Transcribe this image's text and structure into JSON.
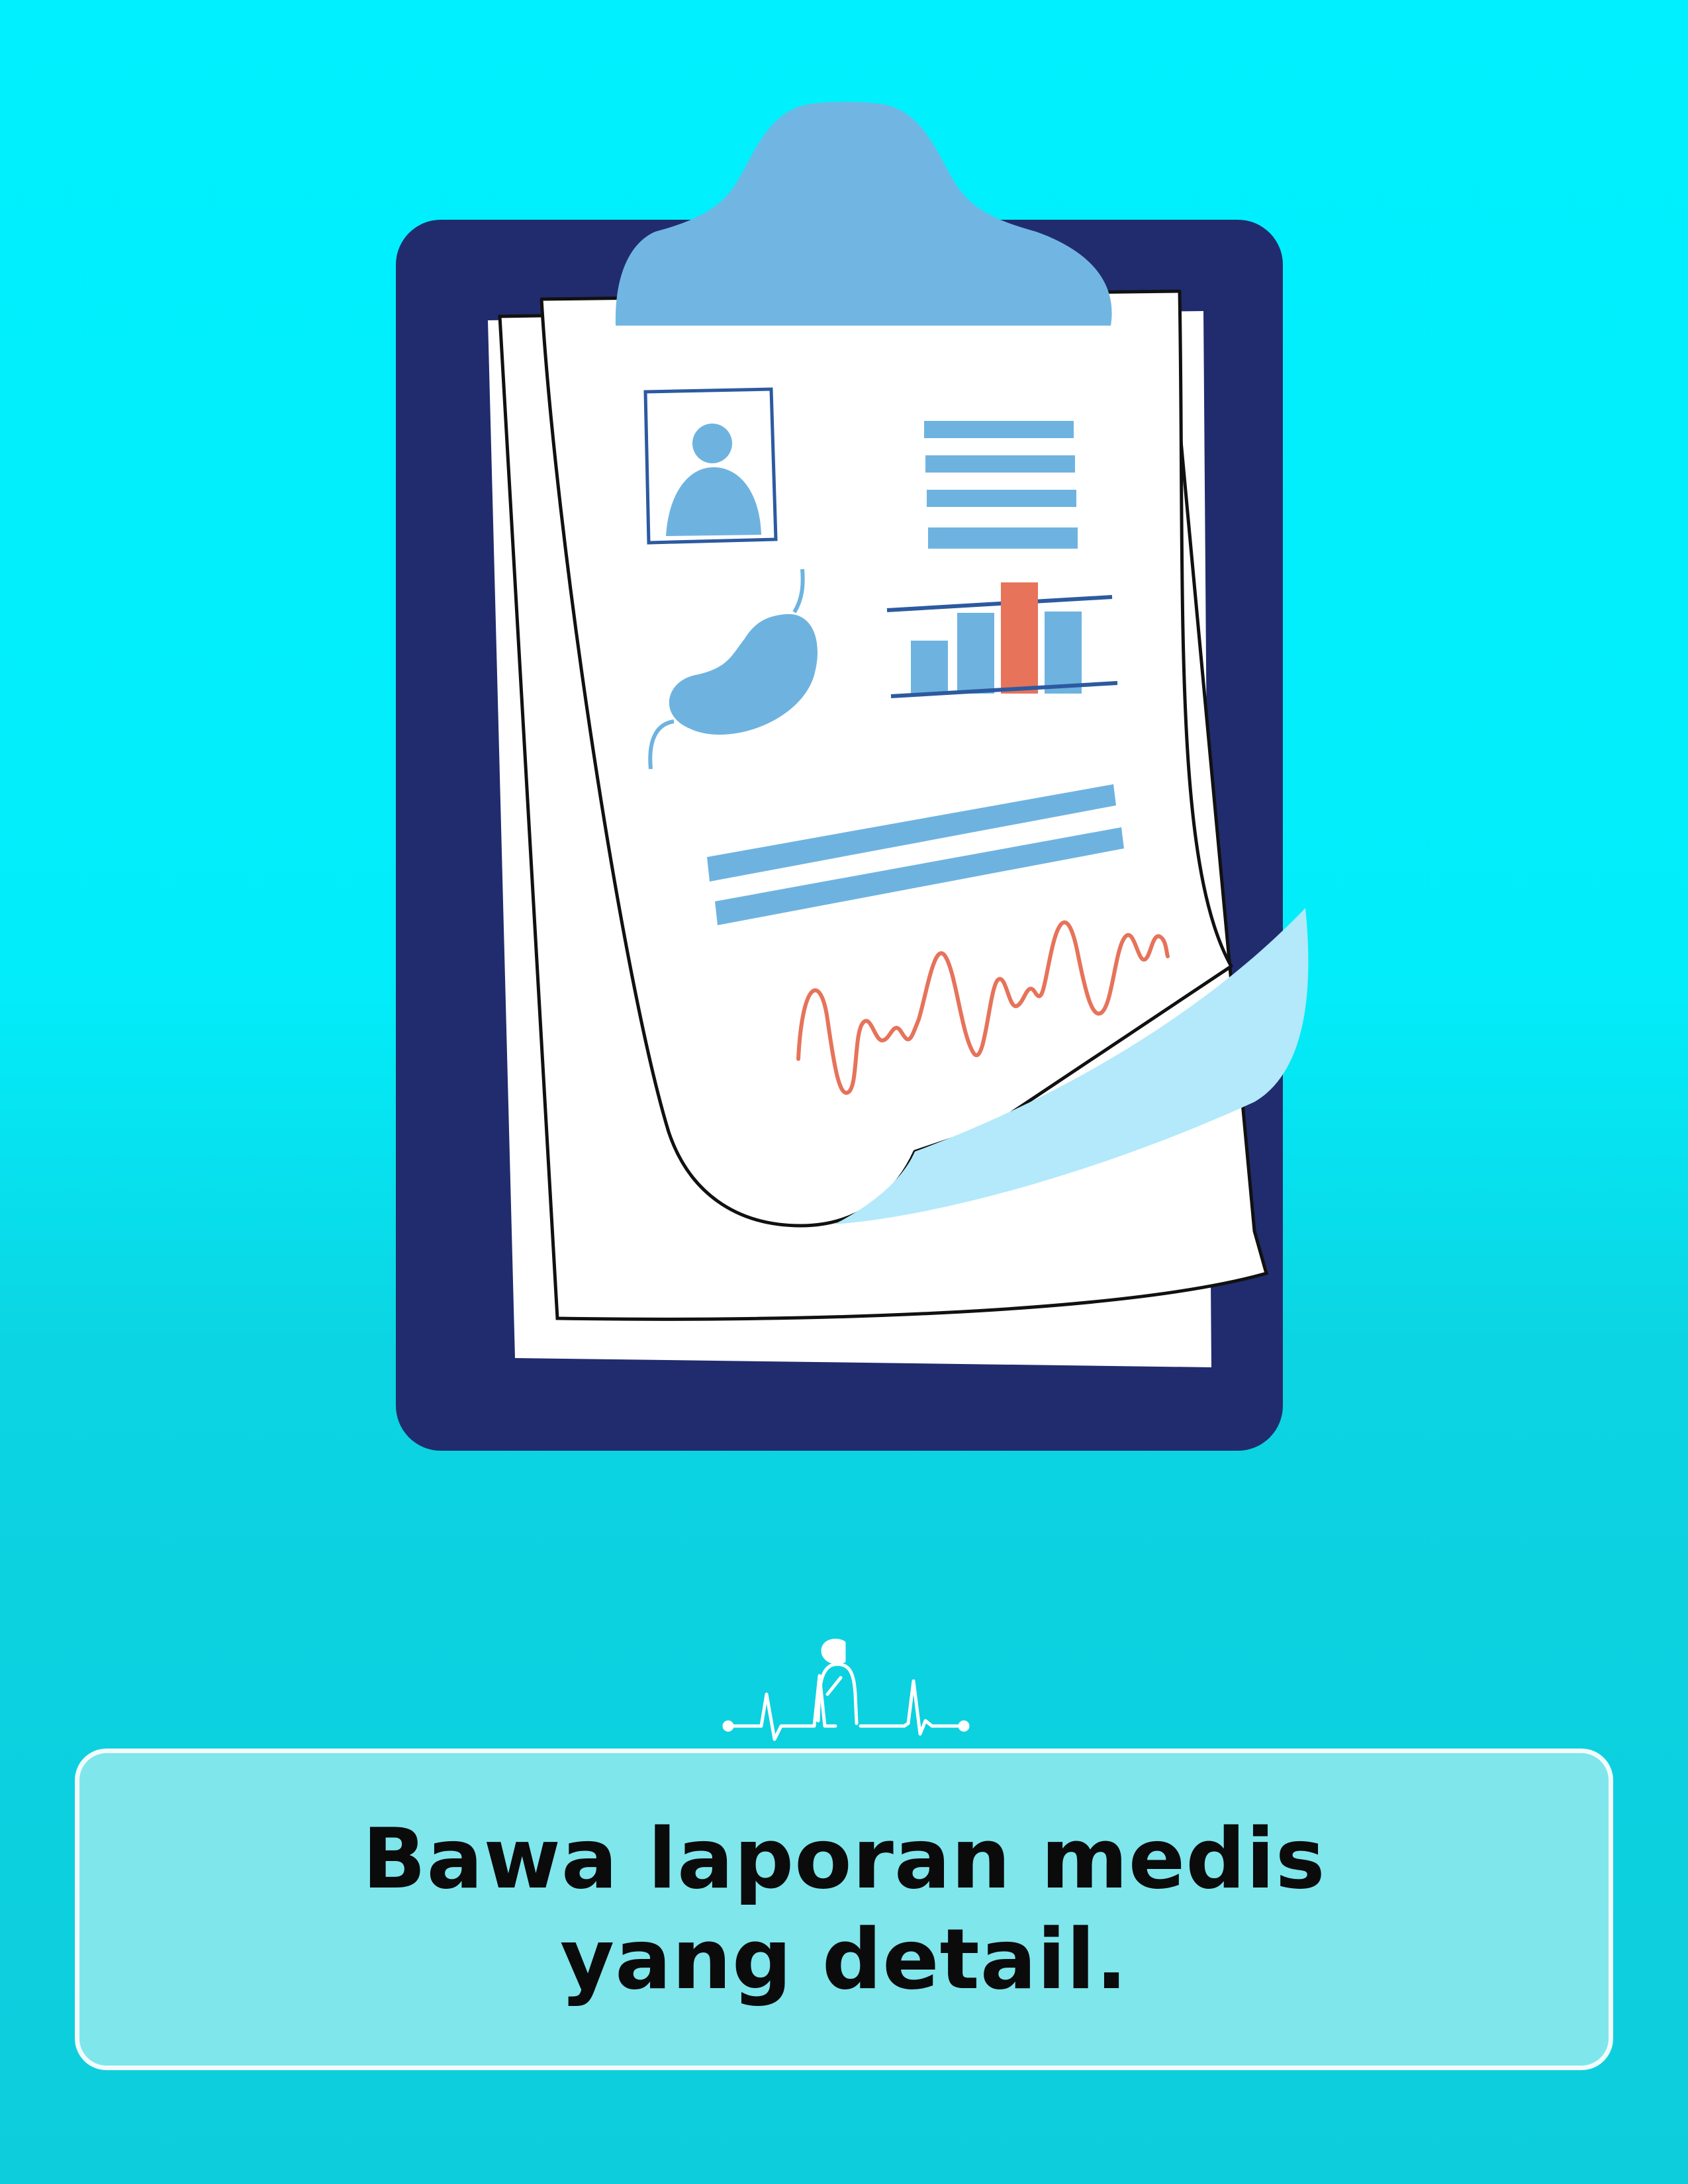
{
  "caption": {
    "text": "Bawa laporan medis yang detail."
  },
  "illustration": {
    "subject": "clipboard-with-medical-report",
    "logo": "heartbeat-person-logo",
    "colors": {
      "background_top": "#00F0FF",
      "background_bottom": "#0DCDDC",
      "clipboard_board": "#212C6E",
      "clipboard_clip": "#71B6E2",
      "paper": "#FFFFFF",
      "paper_curl": "#B3E9FA",
      "accent_blue": "#6EB3E0",
      "accent_orange": "#E6735A",
      "caption_box": "#7FE6EC",
      "caption_border": "#F2FCFD"
    },
    "report_items": [
      "patient-photo-icon",
      "text-lines",
      "organ-icon",
      "bar-chart",
      "summary-lines",
      "ecg-waveform"
    ]
  }
}
